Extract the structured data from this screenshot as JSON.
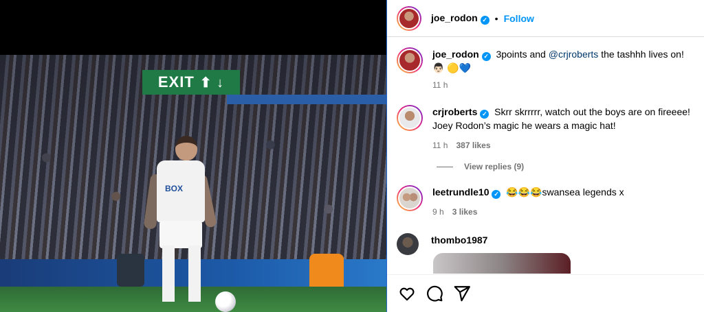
{
  "header": {
    "username": "joe_rodon",
    "dot": "•",
    "follow_label": "Follow"
  },
  "media": {
    "exit_sign": "EXIT",
    "sponsor": "BOX"
  },
  "comments": [
    {
      "username": "joe_rodon",
      "text_before": "3points and ",
      "mention": "@crjroberts",
      "text_after": " the tashhh lives on! 👨🏻 🟡💙",
      "time": "11 h"
    },
    {
      "username": "crjroberts",
      "text": "Skrr skrrrrr, watch out the boys are on fireeee! Joey Rodon’s magic he wears a magic hat!",
      "time": "11 h",
      "likes": "387 likes"
    },
    {
      "username": "leetrundle10",
      "text": "😂😂😂swansea legends x",
      "time": "9 h",
      "likes": "3 likes"
    },
    {
      "username": "thombo1987"
    }
  ],
  "view_replies": "View replies (9)",
  "icons": [
    "heart-icon",
    "comment-icon",
    "share-icon"
  ],
  "colors": {
    "accent": "#0095f6",
    "verified": "#0095f6",
    "mention": "#00376b",
    "muted": "#737373"
  }
}
